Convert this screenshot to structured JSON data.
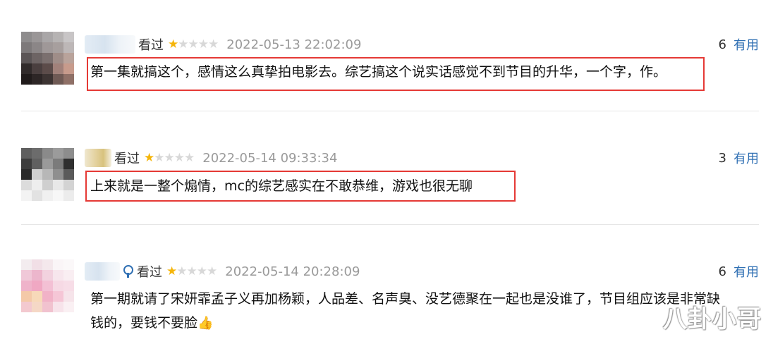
{
  "comments": [
    {
      "watched": "看过",
      "rating": {
        "filled": 1,
        "total": 5
      },
      "time": "2022-05-13 22:02:09",
      "useful_count": "6",
      "useful_label": "有用",
      "text": "第一集就搞这个，感情这么真挚拍电影去。综艺搞这个说实话感觉不到节目的升华，一个字，作。",
      "highlighted": true
    },
    {
      "watched": "看过",
      "rating": {
        "filled": 1,
        "total": 5
      },
      "time": "2022-05-14 09:33:34",
      "useful_count": "3",
      "useful_label": "有用",
      "text": "上来就是一整个煽情，mc的综艺感实在不敢恭维，游戏也很无聊",
      "highlighted": true
    },
    {
      "watched": "看过",
      "rating": {
        "filled": 1,
        "total": 5
      },
      "time": "2022-05-14 20:28:09",
      "useful_count": "6",
      "useful_label": "有用",
      "text_line1": "第一期就请了宋妍霏孟子义再加杨颖，人品差、名声臭、没艺德聚在一起也是没谁了，节目组应该是非常缺",
      "text_line2": "钱的，要钱不要脸",
      "highlighted": false
    }
  ],
  "watermark": "八卦小哥",
  "icons": [
    "star-icon",
    "badge-icon",
    "thumbs-up-icon"
  ],
  "colors": {
    "star": "#f5b50a",
    "link": "#2f6fb3",
    "highlight_border": "#e53935",
    "time": "#9a9a9a"
  }
}
